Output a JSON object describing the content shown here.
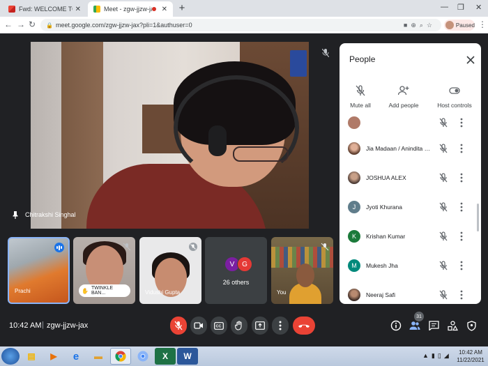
{
  "browser": {
    "tabs": [
      {
        "title": "Fwd: WELCOME TO BOOKAROO",
        "favicon": "gmail-icon",
        "active": false
      },
      {
        "title": "Meet - zgw-jjzw-jax",
        "favicon": "meet-icon",
        "active": true
      }
    ],
    "new_tab": "+",
    "url": "meet.google.com/zgw-jjzw-jax?pli=1&authuser=0",
    "profile_status": "Paused"
  },
  "meet": {
    "main_speaker": "Chitrakshi Singhal",
    "tiles": [
      {
        "name": "Prachi",
        "speaking": true
      },
      {
        "name": "TWINKLE BAN...",
        "hand_raised": true
      },
      {
        "name": "Vidushi Gupta",
        "muted": true
      },
      {
        "avatars": [
          "V",
          "G"
        ],
        "label": "26 others"
      },
      {
        "name": "You",
        "muted": true
      }
    ],
    "avatar_colors": {
      "V": "#7b1fa2",
      "G": "#e53935"
    },
    "people_panel": {
      "title": "People",
      "actions": [
        "Mute all",
        "Add people",
        "Host controls"
      ],
      "participants": [
        {
          "name": "",
          "initial": "",
          "color": "#b07a68",
          "muted": true
        },
        {
          "name": "Jia Madaan / Anindita Ch...",
          "initial": "",
          "color": "#c88a6a",
          "muted": true
        },
        {
          "name": "JOSHUA ALEX",
          "initial": "",
          "color": "#8a6a5a",
          "muted": true
        },
        {
          "name": "Jyoti Khurana",
          "initial": "J",
          "color": "#607d8b",
          "muted": true
        },
        {
          "name": "Krishan Kumar",
          "initial": "K",
          "color": "#1b7a3a",
          "muted": true
        },
        {
          "name": "Mukesh Jha",
          "initial": "M",
          "color": "#00897b",
          "muted": true
        },
        {
          "name": "Neeraj Safi",
          "initial": "",
          "color": "#7a4a3a",
          "muted": true
        }
      ]
    },
    "bottom_bar": {
      "time": "10:42 AM",
      "separator": "|",
      "meeting_code": "zgw-jjzw-jax",
      "participant_count": "31"
    }
  },
  "taskbar": {
    "apps": [
      "explorer",
      "media-player",
      "internet-explorer",
      "file-explorer",
      "chrome",
      "chrome",
      "excel",
      "word"
    ],
    "clock_time": "10:42 AM",
    "clock_date": "11/22/2021"
  }
}
